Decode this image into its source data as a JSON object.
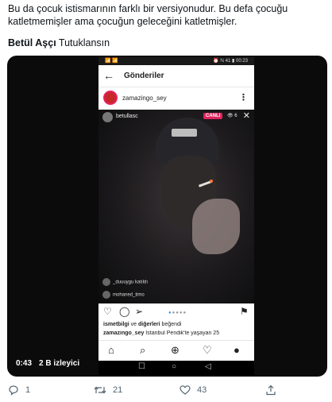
{
  "tweet": {
    "text": "Bu da çocuk istismarının farklı bir versiyonudur. Bu defa çocuğu katletmemişler ama çocuğun geleceğini katletmişler.",
    "quoted_author": "Betül Aşçı",
    "quoted_text": "Tutuklansın"
  },
  "phone": {
    "status_time": "00:23",
    "status_left": "📶 📶",
    "status_right": "⏰ ℕ 41 ▮ 00:23",
    "header_title": "Gönderiler",
    "back_icon": "←",
    "post_username": "zamazingo_sey",
    "more_icon": "⋮"
  },
  "live": {
    "username": "betullasc",
    "badge": "CANLI",
    "viewers": "👁 6",
    "close": "✕",
    "comments": [
      {
        "text": "_duuuygu katıldı"
      },
      {
        "text": "mohaned_timo"
      }
    ]
  },
  "post": {
    "like_icon": "♡",
    "comment_icon": "◯",
    "share_icon": "➢",
    "save_icon": "⚑",
    "likes_user": "ismetbilgi",
    "likes_mid": " ve ",
    "likes_others": "diğerleri",
    "likes_end": " beğendi",
    "caption_user": "zamazingo_sey",
    "caption_text": " İstanbul Pendik'te yaşayan 25"
  },
  "ig_nav": {
    "home": "⌂",
    "search": "⌕",
    "add": "⊕",
    "heart": "♡",
    "profile": "●"
  },
  "android_nav": {
    "square": "☐",
    "circle": "○",
    "back": "◁"
  },
  "video": {
    "time": "0:43",
    "views": "2 B izleyici"
  },
  "actions": {
    "reply_count": "1",
    "retweet_count": "21",
    "like_count": "43"
  }
}
